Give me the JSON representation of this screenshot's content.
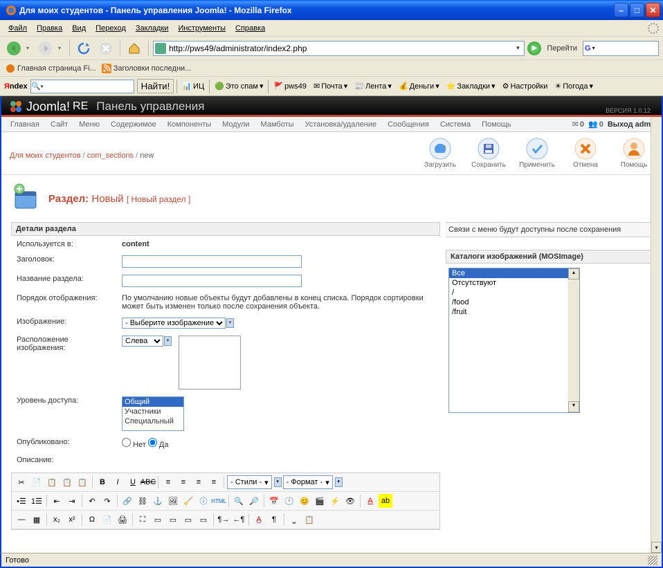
{
  "window": {
    "title": "Для моих студентов - Панель управления Joomla! - Mozilla Firefox"
  },
  "menubar": [
    "Файл",
    "Правка",
    "Вид",
    "Переход",
    "Закладки",
    "Инструменты",
    "Справка"
  ],
  "url": "http://pws49/administrator/index2.php",
  "go_label": "Перейти",
  "bookmarks": [
    {
      "label": "Главная страница Fi..."
    },
    {
      "label": "Заголовки последни..."
    }
  ],
  "yandex": {
    "logo": "Яndex",
    "search_btn": "Найти!",
    "items": [
      "ИЦ",
      "Это спам",
      "pws49",
      "Почта",
      "Лента",
      "Деньги",
      "Закладки",
      "Настройки",
      "Погода"
    ]
  },
  "joomla": {
    "brand": "Joomla!",
    "re": "RE",
    "subtitle": "Панель управления",
    "version": "ВЕРСИЯ 1.0.12",
    "menu": [
      "Главная",
      "Сайт",
      "Меню",
      "Содержимое",
      "Компоненты",
      "Модули",
      "Мамботы",
      "Установка/удаление",
      "Сообщения",
      "Система",
      "Помощь"
    ],
    "badges": {
      "mail": "0",
      "users": "0"
    },
    "logout": "Выход admin",
    "toolbar": [
      {
        "label": "Загрузить"
      },
      {
        "label": "Сохранить"
      },
      {
        "label": "Применить"
      },
      {
        "label": "Отмена"
      },
      {
        "label": "Помощь"
      }
    ],
    "breadcrumb": {
      "a": "Для моих студентов",
      "b": "com_sections",
      "c": "new"
    },
    "section": {
      "heading": "Раздел:",
      "novyi": "Новый",
      "bracket": "[ Новый раздел ]"
    }
  },
  "panel_details": "Детали раздела",
  "form": {
    "used_in_lbl": "Используется в:",
    "used_in_val": "content",
    "title_lbl": "Заголовок:",
    "name_lbl": "Название раздела:",
    "order_lbl": "Порядок отображения:",
    "order_val": "По умолчанию новые объекты будут добавлены в конец списка. Порядок сортировки может быть изменен только после сохранения объекта.",
    "image_lbl": "Изображение:",
    "image_sel": "- Выберите изображение -",
    "imgpos_lbl": "Расположение изображения:",
    "imgpos_sel": "Слева",
    "access_lbl": "Уровень доступа:",
    "access_opts": [
      "Общий",
      "Участники",
      "Специальный"
    ],
    "pub_lbl": "Опубликовано:",
    "pub_no": "Нет",
    "pub_yes": "Да",
    "desc_lbl": "Описание:"
  },
  "right": {
    "note": "Связи с меню будут доступны после сохранения",
    "panel": "Каталоги изображений (MOSImage)",
    "opts": [
      "Все",
      "Отсутствуют",
      "/",
      "/food",
      "/fruit"
    ]
  },
  "editor": {
    "styles": "- Стили -",
    "format": "- Формат -"
  },
  "status": "Готово"
}
